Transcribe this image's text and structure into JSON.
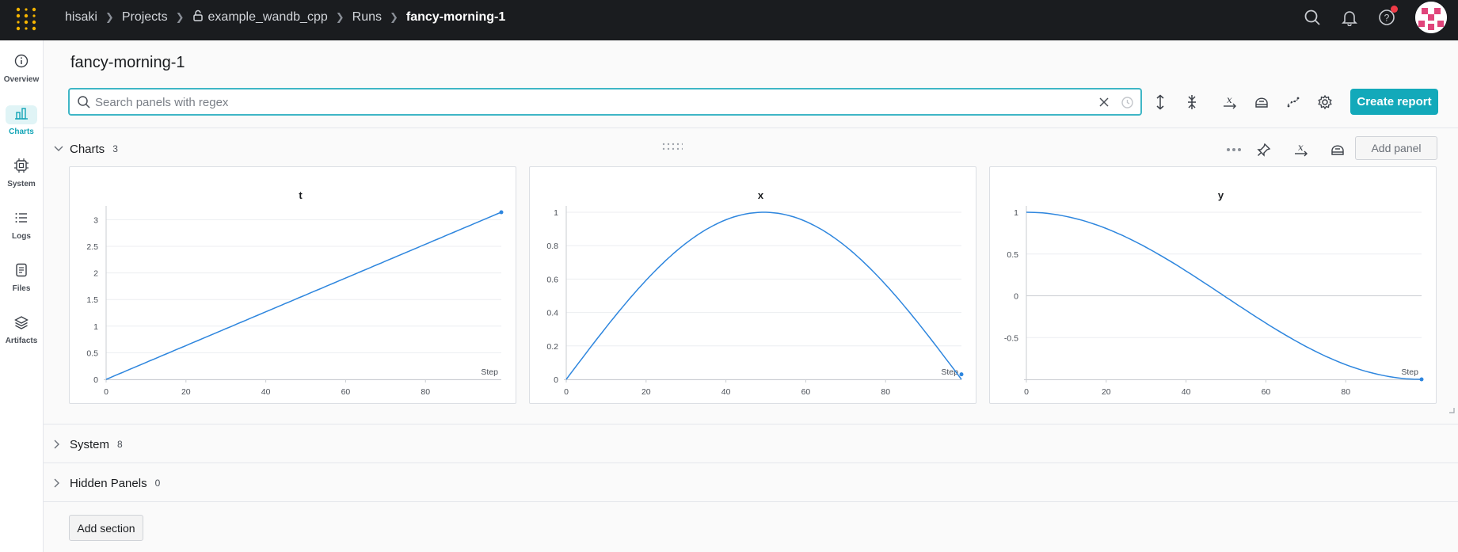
{
  "breadcrumbs": {
    "user": "hisaki",
    "projects": "Projects",
    "project": "example_wandb_cpp",
    "runs": "Runs",
    "run": "fancy-morning-1"
  },
  "sidebar": {
    "items": [
      {
        "label": "Overview",
        "icon": "info-icon"
      },
      {
        "label": "Charts",
        "icon": "bar-chart-icon",
        "active": true
      },
      {
        "label": "System",
        "icon": "chip-icon"
      },
      {
        "label": "Logs",
        "icon": "list-icon"
      },
      {
        "label": "Files",
        "icon": "file-icon"
      },
      {
        "label": "Artifacts",
        "icon": "layers-icon"
      }
    ]
  },
  "page": {
    "title": "fancy-morning-1"
  },
  "search": {
    "placeholder": "Search panels with regex",
    "value": ""
  },
  "toolbar": {
    "create_report": "Create report"
  },
  "sections": {
    "charts": {
      "title": "Charts",
      "count": "3",
      "add_panel": "Add panel"
    },
    "system": {
      "title": "System",
      "count": "8"
    },
    "hidden": {
      "title": "Hidden Panels",
      "count": "0"
    },
    "add_section": "Add section"
  },
  "colors": {
    "accent": "#13a9ba",
    "line": "#2e86de",
    "topbar": "#1a1c1f"
  },
  "chart_data": [
    {
      "type": "line",
      "title": "t",
      "xlabel": "Step",
      "ylabel": "",
      "x_ticks": [
        "0",
        "20",
        "40",
        "60",
        "80"
      ],
      "y_ticks": [
        "0",
        "0.5",
        "1",
        "1.5",
        "2",
        "2.5",
        "3"
      ],
      "xlim": [
        0,
        99
      ],
      "ylim": [
        0,
        3.14
      ],
      "function": "t = step * pi / 99",
      "x": [
        0,
        20,
        40,
        60,
        80,
        99
      ],
      "y": [
        0,
        0.63,
        1.27,
        1.9,
        2.54,
        3.14
      ]
    },
    {
      "type": "line",
      "title": "x",
      "xlabel": "Step",
      "ylabel": "",
      "x_ticks": [
        "0",
        "20",
        "40",
        "60",
        "80"
      ],
      "y_ticks": [
        "0",
        "0.2",
        "0.4",
        "0.6",
        "0.8",
        "1"
      ],
      "xlim": [
        0,
        99
      ],
      "ylim": [
        0,
        1
      ],
      "function": "x = sin(t)",
      "x": [
        0,
        10,
        20,
        30,
        40,
        50,
        60,
        70,
        80,
        90,
        99
      ],
      "y": [
        0,
        0.31,
        0.59,
        0.81,
        0.95,
        1.0,
        0.95,
        0.81,
        0.59,
        0.31,
        0.03
      ]
    },
    {
      "type": "line",
      "title": "y",
      "xlabel": "Step",
      "ylabel": "",
      "x_ticks": [
        "0",
        "20",
        "40",
        "60",
        "80"
      ],
      "y_ticks": [
        "1",
        "0.5",
        "0",
        "-0.5"
      ],
      "xlim": [
        0,
        99
      ],
      "ylim": [
        -1,
        1
      ],
      "function": "y = cos(t)",
      "x": [
        0,
        10,
        20,
        30,
        40,
        50,
        60,
        70,
        80,
        90,
        99
      ],
      "y": [
        1,
        0.95,
        0.81,
        0.59,
        0.31,
        0,
        -0.31,
        -0.59,
        -0.81,
        -0.95,
        -1
      ]
    }
  ]
}
